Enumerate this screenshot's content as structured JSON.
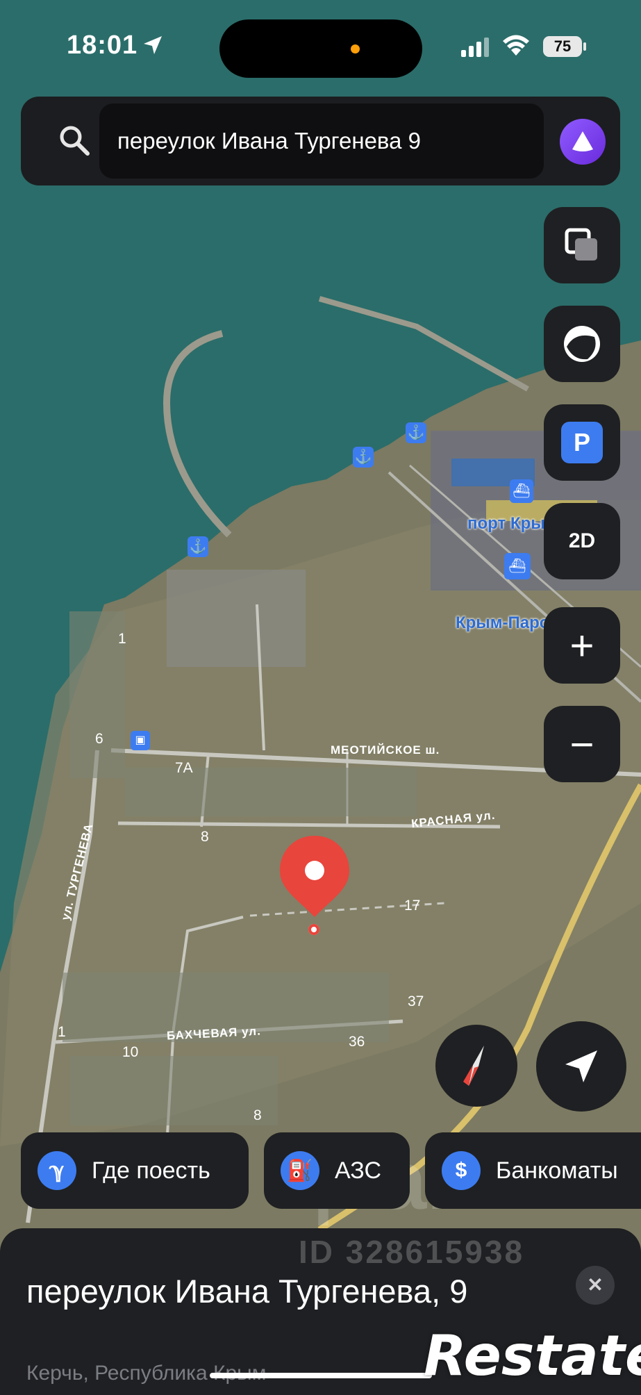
{
  "status_bar": {
    "time": "18:01",
    "battery": "75"
  },
  "search": {
    "query": "переулок Ивана Тургенева 9"
  },
  "map_controls": {
    "parking_label": "P",
    "view_mode_label": "2D",
    "zoom_in_label": "+",
    "zoom_out_label": "−"
  },
  "map_labels": {
    "port": "порт Крым",
    "ferry": "Крым-Паром",
    "street_meotiyskoe": "МЕОТИЙСКОЕ ш.",
    "street_krasnaya": "КРАСНАЯ ул.",
    "street_turgeneva": "ул. ТУРГЕНЕВА",
    "street_bakhchevaya": "БАХЧЕВАЯ ул.",
    "houses": [
      "1",
      "6",
      "7А",
      "8",
      "17",
      "37",
      "1",
      "10",
      "36",
      "8"
    ]
  },
  "chips": [
    {
      "icon": "fork-knife-icon",
      "label": "Где поесть"
    },
    {
      "icon": "fuel-icon",
      "label": "АЗС"
    },
    {
      "icon": "dollar-icon",
      "label": "Банкоматы"
    }
  ],
  "sheet": {
    "title": "переулок Ивана Тургенева, 9",
    "subtitle": "Керчь, Республика Крым"
  },
  "watermarks": {
    "cian": "циан",
    "cian_id": "ID 328615938",
    "restate": "Restate"
  },
  "colors": {
    "sea": "#2b6d6a",
    "land": "#7c7a62",
    "accent_blue": "#3d7cf0",
    "marker_red": "#e8453c",
    "alice_purple": "#7b3fe4"
  }
}
